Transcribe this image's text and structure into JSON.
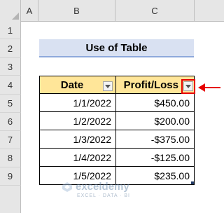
{
  "columns": [
    "A",
    "B",
    "C"
  ],
  "rows": [
    "1",
    "2",
    "3",
    "4",
    "5",
    "6",
    "7",
    "8",
    "9"
  ],
  "title": "Use of Table",
  "table": {
    "headers": {
      "date": "Date",
      "profit_loss": "Profit/Loss"
    },
    "records": [
      {
        "date": "1/1/2022",
        "value": "$450.00"
      },
      {
        "date": "1/2/2022",
        "value": "$200.00"
      },
      {
        "date": "1/3/2022",
        "value": "-$375.00"
      },
      {
        "date": "1/4/2022",
        "value": "-$125.00"
      },
      {
        "date": "1/5/2022",
        "value": "$235.00"
      }
    ]
  },
  "watermark": {
    "name": "exceldemy",
    "tagline": "EXCEL · DATA · BI"
  },
  "colors": {
    "title_bg": "#d9e1f2",
    "header_bg": "#ffe699",
    "highlight": "#e60000"
  }
}
